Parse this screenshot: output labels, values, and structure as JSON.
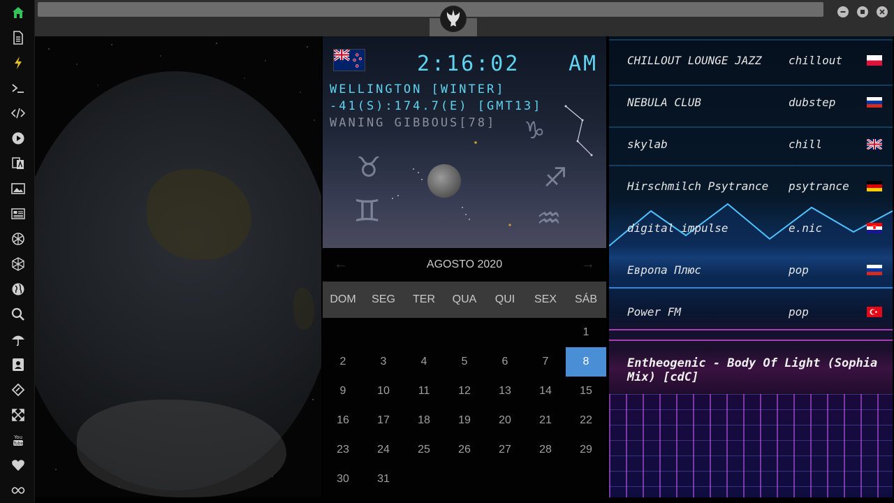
{
  "sidebar": {
    "items": [
      {
        "name": "home-icon",
        "glyph": "home"
      },
      {
        "name": "document-icon",
        "glyph": "doc"
      },
      {
        "name": "lightning-icon",
        "glyph": "bolt"
      },
      {
        "name": "terminal-icon",
        "glyph": "term"
      },
      {
        "name": "code-icon",
        "glyph": "code"
      },
      {
        "name": "play-icon",
        "glyph": "play"
      },
      {
        "name": "translate-icon",
        "glyph": "translate"
      },
      {
        "name": "image-icon",
        "glyph": "image"
      },
      {
        "name": "newspaper-icon",
        "glyph": "news"
      },
      {
        "name": "rebel-icon",
        "glyph": "rebel"
      },
      {
        "name": "polygon-icon",
        "glyph": "hex"
      },
      {
        "name": "globe-icon",
        "glyph": "globe"
      },
      {
        "name": "search-icon",
        "glyph": "search"
      },
      {
        "name": "umbrella-icon",
        "glyph": "umbrella"
      },
      {
        "name": "contact-icon",
        "glyph": "contact"
      },
      {
        "name": "diamond-code-icon",
        "glyph": "diamond"
      },
      {
        "name": "expand-icon",
        "glyph": "expand"
      },
      {
        "name": "youtube-icon",
        "glyph": "youtube"
      },
      {
        "name": "heart-icon",
        "glyph": "heart"
      },
      {
        "name": "infinity-icon",
        "glyph": "infinity"
      }
    ],
    "active_color": "#35c25a",
    "icon_color": "#d0d0d0"
  },
  "clock": {
    "time": "2:16:02",
    "ampm": "AM",
    "location": "WELLINGTON [WINTER]",
    "coords": "-41(S):174.7(E) [GMT13]",
    "moon": "WANING GIBBOUS[78]",
    "accent": "#5fd4f0"
  },
  "calendar": {
    "month": "AGOSTO 2020",
    "prev": "←",
    "next": "→",
    "weekdays": [
      "DOM",
      "SEG",
      "TER",
      "QUA",
      "QUI",
      "SEX",
      "SÁB"
    ],
    "weeks": [
      [
        "",
        "",
        "",
        "",
        "",
        "",
        "1"
      ],
      [
        "2",
        "3",
        "4",
        "5",
        "6",
        "7",
        "8"
      ],
      [
        "9",
        "10",
        "11",
        "12",
        "13",
        "14",
        "15"
      ],
      [
        "16",
        "17",
        "18",
        "19",
        "20",
        "21",
        "22"
      ],
      [
        "23",
        "24",
        "25",
        "26",
        "27",
        "28",
        "29"
      ],
      [
        "30",
        "31",
        "",
        "",
        "",
        "",
        ""
      ]
    ],
    "today": "8",
    "today_color": "#4a8fd6"
  },
  "radio": {
    "stations": [
      {
        "name": "CHILLOUT LOUNGE JAZZ",
        "genre": "chillout",
        "flag": "poland"
      },
      {
        "name": "NEBULA CLUB",
        "genre": "dubstep",
        "flag": "russia"
      },
      {
        "name": "skylab",
        "genre": "chill",
        "flag": "uk"
      },
      {
        "name": "Hirschmilch Psytrance",
        "genre": "psytrance",
        "flag": "germany"
      },
      {
        "name": "digital impulse",
        "genre": "e.nic",
        "flag": "croatia"
      },
      {
        "name": "Европа Плюс",
        "genre": "pop",
        "flag": "russia"
      },
      {
        "name": "Power FM",
        "genre": "pop",
        "flag": "turkey"
      }
    ],
    "now_playing": "Entheogenic - Body Of Light (Sophia Mix) [cdC]"
  }
}
